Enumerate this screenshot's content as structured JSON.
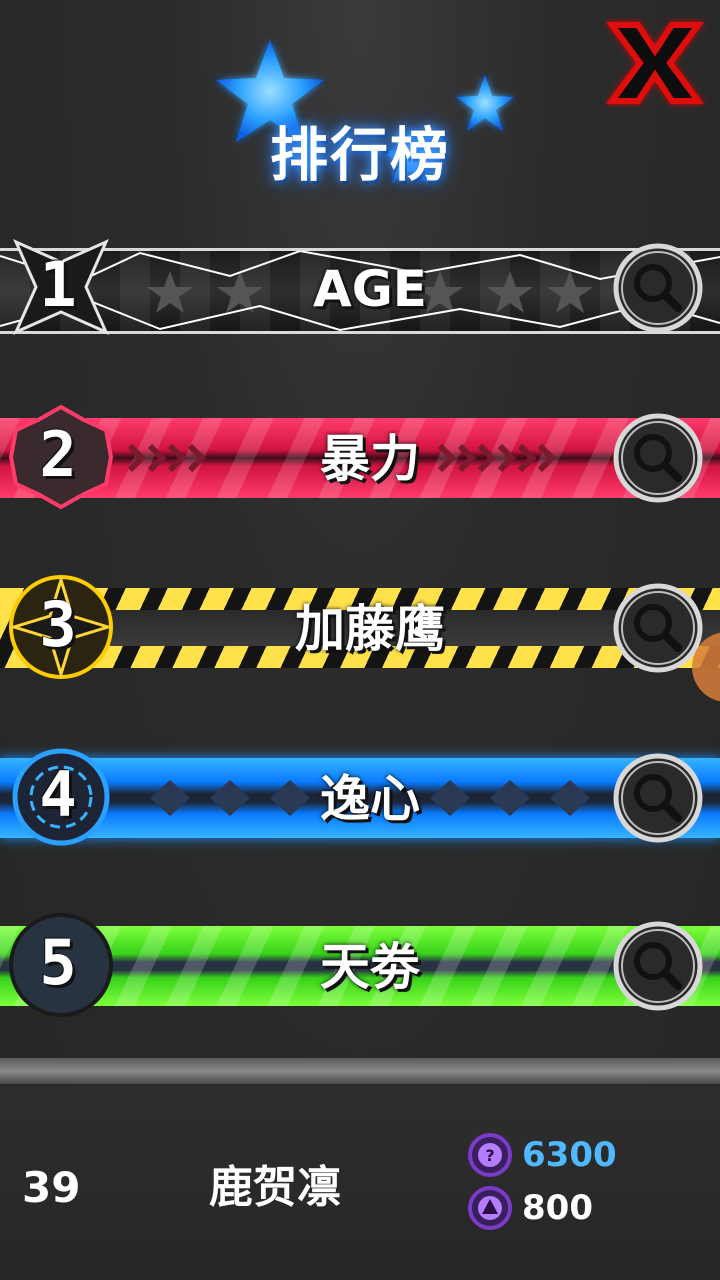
{
  "header": {
    "title": "排行榜"
  },
  "leaderboard": {
    "rows": [
      {
        "rank": "1",
        "name": "AGE",
        "theme": "black"
      },
      {
        "rank": "2",
        "name": "暴力",
        "theme": "red"
      },
      {
        "rank": "3",
        "name": "加藤鹰",
        "theme": "yellow"
      },
      {
        "rank": "4",
        "name": "逸心",
        "theme": "blue"
      },
      {
        "rank": "5",
        "name": "天劵",
        "theme": "green"
      }
    ]
  },
  "player": {
    "rank": "39",
    "name": "鹿贺凛"
  },
  "currencies": [
    {
      "icon": "purple-gem-coin-icon",
      "value": "6300",
      "color": "#4fb8ff"
    },
    {
      "icon": "purple-crystal-coin-icon",
      "value": "800",
      "color": "#ffffff"
    }
  ],
  "colors": {
    "close": "#e01010",
    "title_glow": "#1e8cff",
    "accent_purple": "#7a3cc8"
  }
}
